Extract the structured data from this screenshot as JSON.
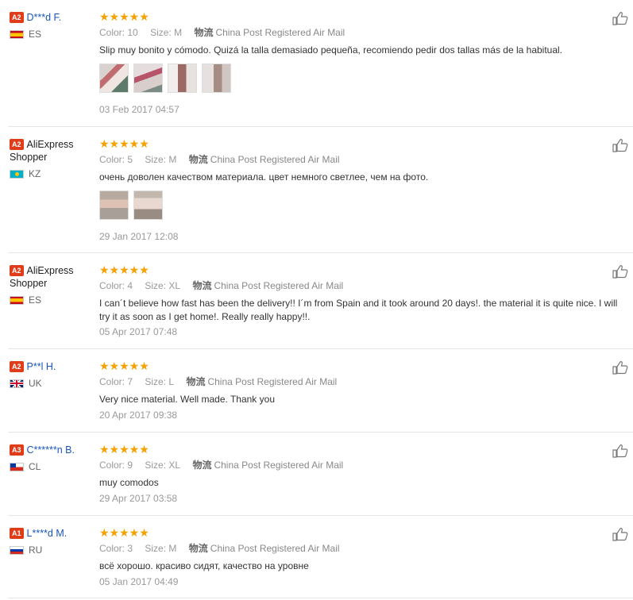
{
  "reviews": [
    {
      "level": "A2",
      "name": "D***d F.",
      "name_style": "link",
      "country": "ES",
      "stars": "★★★★★",
      "color_label": "Color:",
      "color": "10",
      "size_label": "Size:",
      "size": "M",
      "ship_label": "物流",
      "ship": "China Post Registered Air Mail",
      "text": "Slip muy bonito y cómodo. Quizá la talla demasiado pequeña, recomiendo pedir dos tallas más de la habitual.",
      "photos": 4,
      "date": "03 Feb 2017 04:57"
    },
    {
      "level": "A2",
      "name": "AliExpress Shopper",
      "name_style": "plain",
      "country": "KZ",
      "stars": "★★★★★",
      "color_label": "Color:",
      "color": "5",
      "size_label": "Size:",
      "size": "M",
      "ship_label": "物流",
      "ship": "China Post Registered Air Mail",
      "text": "очень доволен качеством материала. цвет немного светлее, чем на фото.",
      "photos": 2,
      "date": "29 Jan 2017 12:08"
    },
    {
      "level": "A2",
      "name": "AliExpress Shopper",
      "name_style": "plain",
      "country": "ES",
      "stars": "★★★★★",
      "color_label": "Color:",
      "color": "4",
      "size_label": "Size:",
      "size": "XL",
      "ship_label": "物流",
      "ship": "China Post Registered Air Mail",
      "text": "I can´t believe how fast has been the delivery!! I´m from Spain and it took around 20 days!. the material it is quite nice. I will try it as soon as I get home!. Really really happy!!.",
      "photos": 0,
      "date": "05 Apr 2017 07:48"
    },
    {
      "level": "A2",
      "name": "P**l H.",
      "name_style": "link",
      "country": "UK",
      "stars": "★★★★★",
      "color_label": "Color:",
      "color": "7",
      "size_label": "Size:",
      "size": "L",
      "ship_label": "物流",
      "ship": "China Post Registered Air Mail",
      "text": "Very nice material. Well made. Thank you",
      "photos": 0,
      "date": "20 Apr 2017 09:38"
    },
    {
      "level": "A3",
      "name": "C******n B.",
      "name_style": "link",
      "country": "CL",
      "stars": "★★★★★",
      "color_label": "Color:",
      "color": "9",
      "size_label": "Size:",
      "size": "XL",
      "ship_label": "物流",
      "ship": "China Post Registered Air Mail",
      "text": "muy comodos",
      "photos": 0,
      "date": "29 Apr 2017 03:58"
    },
    {
      "level": "A1",
      "name": "L****d M.",
      "name_style": "link",
      "country": "RU",
      "stars": "★★★★★",
      "color_label": "Color:",
      "color": "3",
      "size_label": "Size:",
      "size": "M",
      "ship_label": "物流",
      "ship": "China Post Registered Air Mail",
      "text": "всё хорошо. красиво сидят, качество на уровне",
      "photos": 0,
      "date": "05 Jan 2017 04:49"
    }
  ],
  "icons": {
    "like": "thumbs-up-icon",
    "star": "star-icon"
  },
  "colors": {
    "stars": "#f5a100",
    "level_badge": "#e03c1a",
    "name_link": "#1a56b8"
  }
}
